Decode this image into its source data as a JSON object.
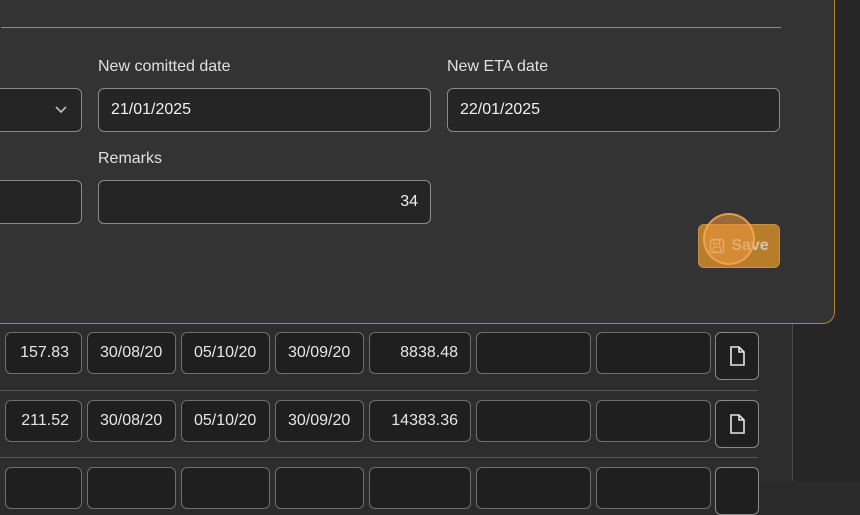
{
  "form": {
    "new_committed_date_label": "New comitted date",
    "new_committed_date_value": "21/01/2025",
    "new_eta_date_label": "New ETA date",
    "new_eta_date_value": "22/01/2025",
    "remarks_label": "Remarks",
    "remarks_value": "34",
    "save_label": "Save"
  },
  "table": {
    "rows": [
      {
        "amount": "157.83",
        "date1": "30/08/20",
        "date2": "05/10/20",
        "date3": "30/09/20",
        "total": "8838.48"
      },
      {
        "amount": "211.52",
        "date1": "30/08/20",
        "date2": "05/10/20",
        "date3": "30/09/20",
        "total": "14383.36"
      },
      {
        "amount": "",
        "date1": "",
        "date2": "",
        "date3": "",
        "total": ""
      }
    ]
  },
  "icons": {
    "document": "file-icon",
    "chevron": "chevron-down-icon",
    "save": "floppy-disk-icon"
  },
  "colors": {
    "accent": "#d08a2a",
    "modal_border": "#b8842e"
  }
}
